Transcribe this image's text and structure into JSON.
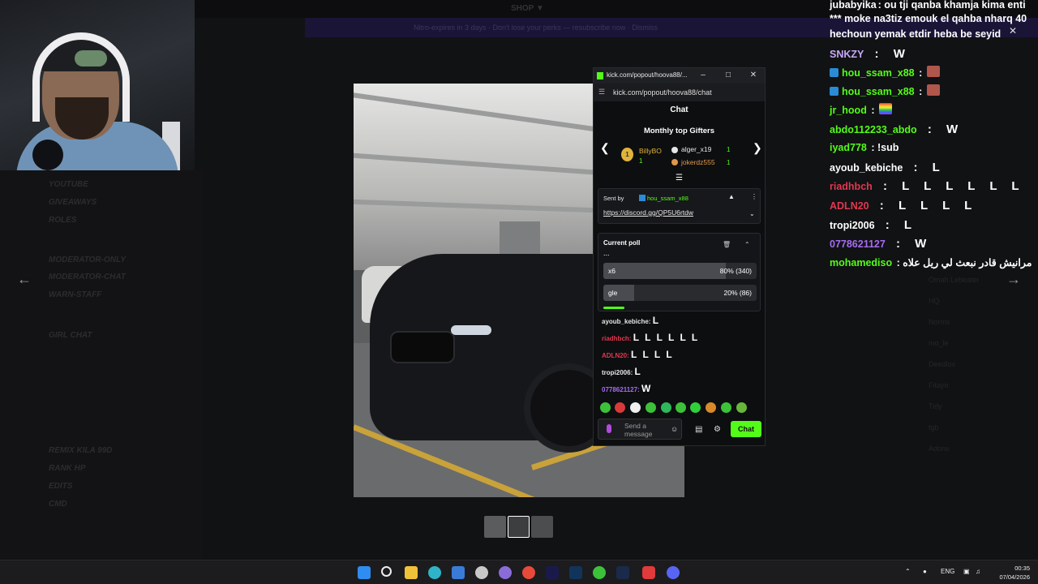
{
  "background_app": {
    "top_title": "SHOP ▼",
    "banner": "Nitro-expires in 3 days · Don't lose your perks — resubscribe now · Dismiss",
    "channels": [
      "YOUTUBE",
      "GIVEAWAYS",
      "ROLES",
      "MODERATOR-ONLY",
      "MODERATOR-CHAT",
      "WARN-STAFF",
      "GIRL CHAT",
      "REMIX KILA 99D",
      "RANK HP",
      "EDITS",
      "CMD"
    ],
    "members": [
      "Omah Lebeater",
      "HQ",
      "Norms",
      "mo_le",
      "Deedlox",
      "Fitayo",
      "Tidy",
      "tgb",
      "Adorw"
    ]
  },
  "popout": {
    "window_title": "kick.com/popout/hoova88/...",
    "url": "kick.com/popout/hoova88/chat",
    "header": "Chat",
    "gifters_title": "Monthly top Gifters",
    "gifters": [
      {
        "rank": "1",
        "name": "BillyBO",
        "count": "1",
        "color": "#e1b43a"
      },
      {
        "rank": "2",
        "name": "alger_x19",
        "count": "1",
        "color": "#e6e6e6"
      },
      {
        "rank": "3",
        "name": "jokerdz555",
        "count": "1",
        "color": "#e0994a"
      }
    ],
    "pinned": {
      "sent_by_label": "Sent by",
      "user": "hou_ssam_x88",
      "link": "https://discord.gg/QP5U6rtdw"
    },
    "poll": {
      "title": "Current poll",
      "question": "...",
      "options": [
        {
          "label": "x6",
          "percent": "80%",
          "votes": "(340)",
          "fraction": 0.8
        },
        {
          "label": "gle",
          "percent": "20%",
          "votes": "(86)",
          "fraction": 0.2
        }
      ],
      "time_remaining_fraction": 0.14
    },
    "messages": [
      {
        "user": "ayoub_kebiche:",
        "content": "L",
        "color": "#e6e6e6"
      },
      {
        "user": "riadhbch:",
        "content": "L L L L L L",
        "color": "#e0384f"
      },
      {
        "user": "ADLN20:",
        "content": "L L L L",
        "color": "#e0384f"
      },
      {
        "user": "tropi2006:",
        "content": "L",
        "color": "#e6e6e6"
      },
      {
        "user": "0778621127:",
        "content": "W",
        "color": "#a66cf2"
      }
    ],
    "send_placeholder": "Send a message",
    "chat_button": "Chat"
  },
  "right_chat": [
    {
      "user": "jubabyika",
      "text": ": ou tji qanba khamja kima enti",
      "color": "#ffffff",
      "big": false
    },
    {
      "user": "",
      "text": "*** moke na3tiz emouk el qahba nharq 40",
      "color": "#ffffff",
      "big": false
    },
    {
      "user": "",
      "text": "hechoun yemak etdir heba be seyid",
      "color": "#ffffff",
      "big": false
    },
    {
      "user": "SNKZY",
      "text": " : W",
      "color": "#c8a8f8",
      "big": true
    },
    {
      "user": "hou_ssam_x88",
      "text": " :",
      "color": "#53fc18",
      "big": false
    },
    {
      "user": "hou_ssam_x88",
      "text": " :",
      "color": "#53fc18",
      "big": false
    },
    {
      "user": "jr_hood",
      "text": " :",
      "color": "#53fc18",
      "big": false
    },
    {
      "user": "abdo112233_abdo",
      "text": " : W",
      "color": "#53fc18",
      "big": true
    },
    {
      "user": "iyad778",
      "text": " : !sub",
      "color": "#53fc18",
      "big": false
    },
    {
      "user": "ayoub_kebiche",
      "text": " : L",
      "color": "#ffffff",
      "big": true
    },
    {
      "user": "riadhbch",
      "text": " : L L L L L L",
      "color": "#e0384f",
      "big": true
    },
    {
      "user": "ADLN20",
      "text": " : L L L L",
      "color": "#e0384f",
      "big": true
    },
    {
      "user": "tropi2006",
      "text": " : L",
      "color": "#ffffff",
      "big": true
    },
    {
      "user": "0778621127",
      "text": " : W",
      "color": "#a66cf2",
      "big": true
    },
    {
      "user": "mohamediso",
      "text": " : مرانيش قادر نبعث لي ريل علاه",
      "color": "#53fc18",
      "big": false
    }
  ],
  "taskbar": {
    "language": "ENG",
    "time": "00:35",
    "date": "07/04/2026"
  },
  "colors": {
    "kick_green": "#53fc18",
    "poll_fill": "#4a4b50"
  }
}
